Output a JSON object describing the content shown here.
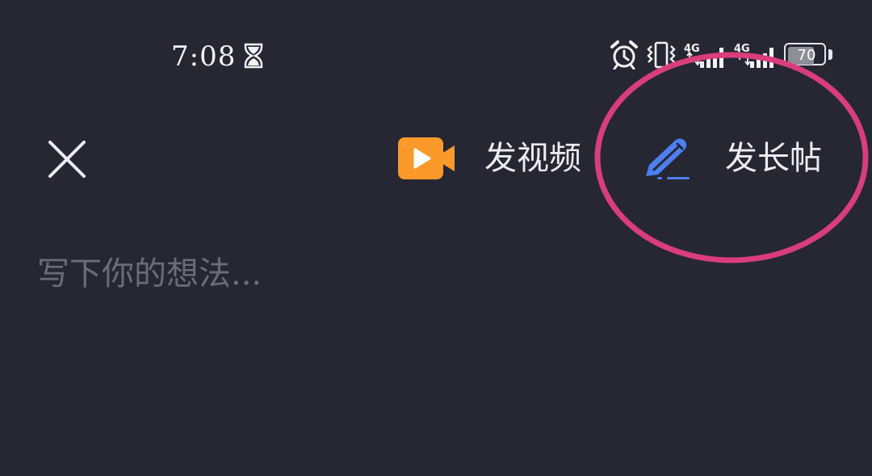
{
  "status_bar": {
    "time": "7:08",
    "battery_text": "70",
    "battery_level": 0.7,
    "icons": [
      "hourglass-icon",
      "alarm-icon",
      "vibrate-icon",
      "signal-icon",
      "signal-icon",
      "battery-icon"
    ]
  },
  "header": {
    "close_icon": "close-icon",
    "post_video": {
      "label": "发视频",
      "icon": "video-camera-icon",
      "icon_color": "#fb9a2a"
    },
    "post_long": {
      "label": "发长帖",
      "icon": "pen-icon",
      "icon_color": "#4d7ff0"
    }
  },
  "composer": {
    "placeholder": "写下你的想法...",
    "value": ""
  },
  "colors": {
    "background": "#262733",
    "text": "#ecedf2",
    "placeholder": "#6b6c76",
    "annotation": "#d93d7b"
  }
}
